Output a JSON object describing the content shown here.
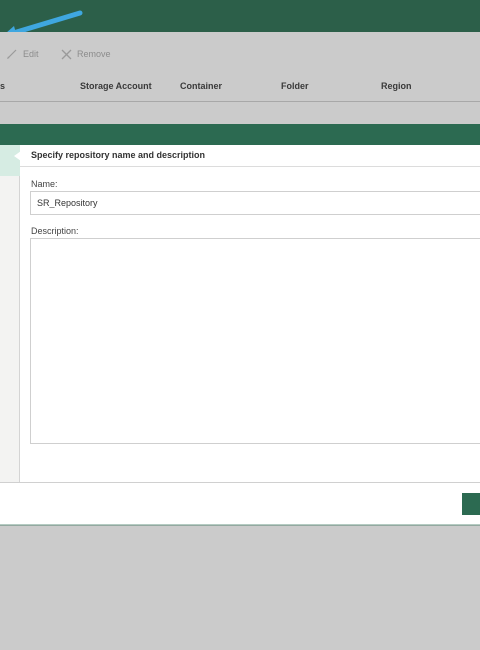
{
  "toolbar": {
    "edit_label": "Edit",
    "remove_label": "Remove"
  },
  "table": {
    "columns": [
      "s",
      "Storage Account",
      "Container",
      "Folder",
      "Region"
    ]
  },
  "dialog": {
    "step_title": "Specify repository name and description",
    "name_label": "Name:",
    "name_value": "SR_Repository",
    "description_label": "Description:",
    "description_value": ""
  },
  "colors": {
    "header": "#2c5f49",
    "accent": "#2c6a51",
    "arrow": "#3fa7e0",
    "active_step": "#d6ece3"
  },
  "icons": {
    "edit": "pencil-icon",
    "remove": "close-icon",
    "annotation": "arrow-icon"
  }
}
